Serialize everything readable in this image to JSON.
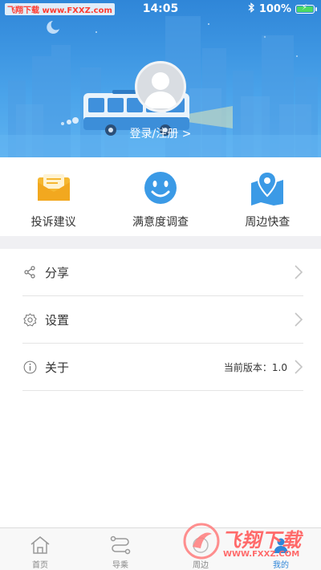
{
  "status_bar": {
    "watermark": "飞翔下载 www.FXXZ.com",
    "time": "14:05",
    "battery": "100%",
    "battery_level": 1.0,
    "icons": [
      "bluetooth-icon",
      "battery-icon"
    ]
  },
  "profile": {
    "login_label": "登录/注册 >"
  },
  "quick_actions": [
    {
      "label": "投诉建议",
      "icon": "mail-icon",
      "color": "#f5b730"
    },
    {
      "label": "满意度调查",
      "icon": "smiley-icon",
      "color": "#3b9ae6"
    },
    {
      "label": "周边快查",
      "icon": "map-pin-icon",
      "color": "#3b9ae6"
    }
  ],
  "menu": [
    {
      "label": "分享",
      "icon": "share-icon",
      "value": ""
    },
    {
      "label": "设置",
      "icon": "gear-icon",
      "value": ""
    },
    {
      "label": "关于",
      "icon": "info-icon",
      "value": "当前版本：1.0"
    }
  ],
  "tabs": [
    {
      "label": "首页",
      "icon": "home-icon",
      "active": false
    },
    {
      "label": "导乘",
      "icon": "route-icon",
      "active": false
    },
    {
      "label": "周边",
      "icon": "nearby-icon",
      "active": false
    },
    {
      "label": "我的",
      "icon": "profile-icon",
      "active": true
    }
  ],
  "watermark_brand": {
    "name": "飞翔下载",
    "url": "WWW.FXXZ.COM"
  },
  "colors": {
    "accent": "#2f86d8",
    "header_top": "#2f86d8",
    "header_bottom": "#5fb3f0",
    "separator": "#f0f0f3"
  }
}
